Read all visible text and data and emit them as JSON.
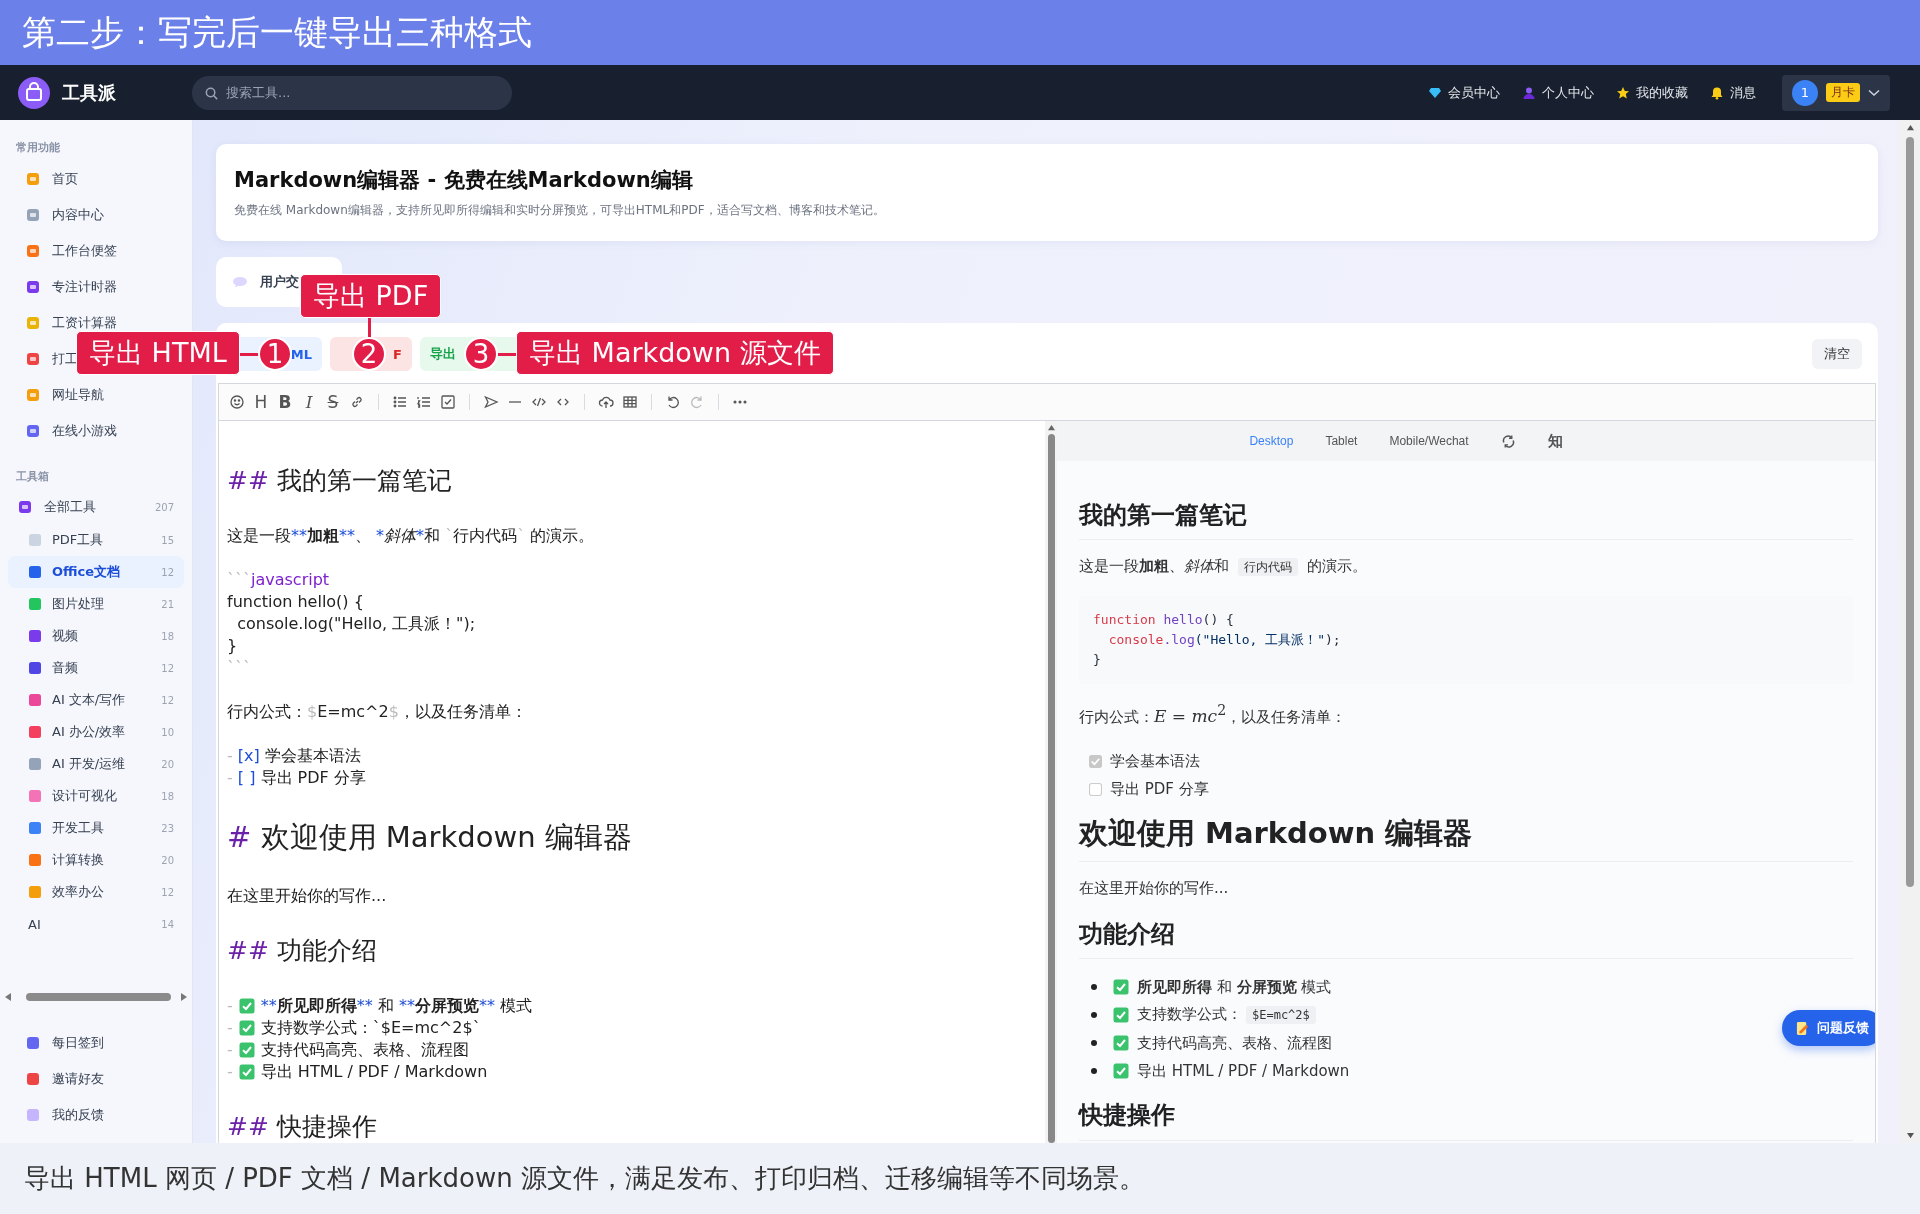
{
  "banner": {
    "title": "第二步：写完后一键导出三种格式"
  },
  "navbar": {
    "brand": "工具派",
    "search": {
      "placeholder": "搜索工具..."
    },
    "links": [
      {
        "kind": "vip",
        "label": "会员中心"
      },
      {
        "kind": "user",
        "label": "个人中心"
      },
      {
        "kind": "star",
        "label": "我的收藏"
      },
      {
        "kind": "bell",
        "label": "消息"
      }
    ],
    "account": {
      "avatar": "1",
      "badge": "月卡"
    }
  },
  "sidebar": {
    "sections": [
      {
        "title": "常用功能",
        "items": [
          {
            "label": "首页",
            "selected": false
          },
          {
            "label": "内容中心",
            "selected": false
          },
          {
            "label": "工作台便签",
            "selected": false
          },
          {
            "label": "专注计时器",
            "selected": false
          },
          {
            "label": "工资计算器",
            "selected": false
          },
          {
            "label": "打工",
            "selected": false
          },
          {
            "label": "网址导航",
            "selected": false
          },
          {
            "label": "在线小游戏",
            "selected": false
          }
        ]
      },
      {
        "title": "工具箱",
        "items": [
          {
            "label": "全部工具",
            "count": "207",
            "selected": false,
            "children": [
              {
                "label": "PDF工具",
                "count": "15",
                "selected": false
              },
              {
                "label": "Office文档",
                "count": "12",
                "selected": true
              },
              {
                "label": "图片处理",
                "count": "21",
                "selected": false
              },
              {
                "label": "视频",
                "count": "18",
                "selected": false
              },
              {
                "label": "音频",
                "count": "12",
                "selected": false
              },
              {
                "label": "AI 文本/写作",
                "count": "12",
                "selected": false
              },
              {
                "label": "AI 办公/效率",
                "count": "10",
                "selected": false
              },
              {
                "label": "AI 开发/运维",
                "count": "20",
                "selected": false
              },
              {
                "label": "设计可视化",
                "count": "18",
                "selected": false
              },
              {
                "label": "开发工具",
                "count": "23",
                "selected": false
              },
              {
                "label": "计算转换",
                "count": "20",
                "selected": false
              },
              {
                "label": "效率办公",
                "count": "12",
                "selected": false
              },
              {
                "label": "AI",
                "count": "14",
                "selected": false,
                "kind": "plain"
              }
            ]
          }
        ]
      }
    ],
    "footer_items": [
      {
        "label": "每日签到"
      },
      {
        "label": "邀请好友"
      },
      {
        "label": "我的反馈"
      }
    ]
  },
  "page_header": {
    "title": "Markdown编辑器 - 免费在线Markdown编辑",
    "description": "免费在线 Markdown编辑器，支持所见即所得编辑和实时分屏预览，可导出HTML和PDF，适合写文档、博客和技术笔记。"
  },
  "tab": {
    "label": "用户交"
  },
  "export_buttons": [
    {
      "kind": "html",
      "label": "ML"
    },
    {
      "kind": "pdf",
      "label": "F"
    },
    {
      "kind": "markdown",
      "label": "导出"
    }
  ],
  "clear_button": "清空",
  "toolbar": [
    {
      "kind": "emoji",
      "disabled": false
    },
    {
      "kind": "heading",
      "text": "H",
      "disabled": false
    },
    {
      "kind": "bold",
      "text": "B",
      "disabled": false
    },
    {
      "kind": "italic",
      "text": "I",
      "disabled": false
    },
    {
      "kind": "strike",
      "text": "S",
      "disabled": false
    },
    {
      "kind": "link",
      "disabled": false
    },
    {
      "kind": "sep"
    },
    {
      "kind": "list",
      "disabled": false
    },
    {
      "kind": "ordered",
      "disabled": false
    },
    {
      "kind": "task",
      "disabled": false
    },
    {
      "kind": "sep"
    },
    {
      "kind": "quote",
      "disabled": false
    },
    {
      "kind": "line",
      "disabled": false
    },
    {
      "kind": "code",
      "disabled": false
    },
    {
      "kind": "inline-code",
      "disabled": false
    },
    {
      "kind": "sep"
    },
    {
      "kind": "upload",
      "disabled": false
    },
    {
      "kind": "table",
      "disabled": false
    },
    {
      "kind": "sep"
    },
    {
      "kind": "undo",
      "disabled": false
    },
    {
      "kind": "redo",
      "disabled": true
    },
    {
      "kind": "sep"
    },
    {
      "kind": "more",
      "disabled": false
    }
  ],
  "source_lines": [
    {
      "kind": "h2",
      "marker": "##",
      "text": "我的第一篇笔记"
    },
    {
      "kind": "blank"
    },
    {
      "kind": "text",
      "parts": [
        {
          "t": "这是一段"
        },
        {
          "t": "**",
          "kind": "mark"
        },
        {
          "t": "加粗",
          "kind": "bold"
        },
        {
          "t": "**",
          "kind": "mark"
        },
        {
          "t": "、 "
        },
        {
          "t": "*",
          "kind": "mark"
        },
        {
          "t": "斜体",
          "kind": "italic"
        },
        {
          "t": "*",
          "kind": "mark"
        },
        {
          "t": "和 "
        },
        {
          "t": "`",
          "kind": "dim"
        },
        {
          "t": "行内代码"
        },
        {
          "t": "`",
          "kind": "dim"
        },
        {
          "t": " 的演示。"
        }
      ]
    },
    {
      "kind": "blank"
    },
    {
      "kind": "text",
      "parts": [
        {
          "t": "```",
          "kind": "dim"
        },
        {
          "t": "javascript",
          "kind": "lang"
        }
      ]
    },
    {
      "kind": "text",
      "parts": [
        {
          "t": "function hello() {"
        }
      ]
    },
    {
      "kind": "text",
      "parts": [
        {
          "t": "  console.log(\"Hello, 工具派！\");"
        }
      ]
    },
    {
      "kind": "text",
      "parts": [
        {
          "t": "}"
        }
      ]
    },
    {
      "kind": "text",
      "parts": [
        {
          "t": "```",
          "kind": "dim"
        }
      ]
    },
    {
      "kind": "blank"
    },
    {
      "kind": "text",
      "parts": [
        {
          "t": "行内公式："
        },
        {
          "t": "$",
          "kind": "dim"
        },
        {
          "t": "E=mc^2"
        },
        {
          "t": "$",
          "kind": "dim"
        },
        {
          "t": "，以及任务清单："
        }
      ]
    },
    {
      "kind": "blank"
    },
    {
      "kind": "text",
      "parts": [
        {
          "t": "- ",
          "kind": "dim"
        },
        {
          "t": "[x]",
          "kind": "box"
        },
        {
          "t": " 学会基本语法"
        }
      ]
    },
    {
      "kind": "text",
      "parts": [
        {
          "t": "- ",
          "kind": "dim"
        },
        {
          "t": "[ ]",
          "kind": "box"
        },
        {
          "t": " 导出 PDF 分享"
        }
      ]
    },
    {
      "kind": "blank"
    },
    {
      "kind": "h1",
      "marker": "#",
      "text": "欢迎使用 Markdown 编辑器"
    },
    {
      "kind": "blank"
    },
    {
      "kind": "text",
      "parts": [
        {
          "t": "在这里开始你的写作..."
        }
      ]
    },
    {
      "kind": "blank"
    },
    {
      "kind": "h2",
      "marker": "##",
      "text": "功能介绍"
    },
    {
      "kind": "blank"
    },
    {
      "kind": "check",
      "dash": "-",
      "parts": [
        {
          "t": "**",
          "kind": "mark"
        },
        {
          "t": "所见即所得",
          "kind": "bold"
        },
        {
          "t": "**",
          "kind": "mark"
        },
        {
          "t": " 和 "
        },
        {
          "t": "**",
          "kind": "mark"
        },
        {
          "t": "分屏预览",
          "kind": "bold"
        },
        {
          "t": "**",
          "kind": "mark"
        },
        {
          "t": " 模式"
        }
      ]
    },
    {
      "kind": "check",
      "dash": "-",
      "parts": [
        {
          "t": "支持数学公式：`$E=mc^2$`"
        }
      ]
    },
    {
      "kind": "check",
      "dash": "-",
      "parts": [
        {
          "t": "支持代码高亮、表格、流程图"
        }
      ]
    },
    {
      "kind": "check",
      "dash": "-",
      "parts": [
        {
          "t": "导出 HTML / PDF / Markdown"
        }
      ]
    },
    {
      "kind": "blank"
    },
    {
      "kind": "h2",
      "marker": "##",
      "text": "快捷操作"
    }
  ],
  "preview": {
    "tabs": [
      {
        "label": "Desktop",
        "selected": true
      },
      {
        "label": "Tablet",
        "selected": false
      },
      {
        "label": "Mobile/Wechat",
        "selected": false
      }
    ],
    "zhihu": "知",
    "blocks": [
      {
        "kind": "h2",
        "text": "我的第一篇笔记"
      },
      {
        "kind": "p",
        "parts": [
          {
            "t": "这是一段"
          },
          {
            "t": "加粗",
            "kind": "bold"
          },
          {
            "t": "、"
          },
          {
            "t": "斜体",
            "kind": "italic"
          },
          {
            "t": "和 "
          },
          {
            "t": "行内代码",
            "kind": "code"
          },
          {
            "t": " 的演示。"
          }
        ]
      },
      {
        "kind": "code",
        "lines": [
          [
            {
              "t": "function ",
              "kind": "kw"
            },
            {
              "t": "hello",
              "kind": "fn"
            },
            {
              "t": "() {"
            }
          ],
          [
            {
              "t": "  console",
              "kind": "kw"
            },
            {
              "t": ".log",
              "kind": "fn"
            },
            {
              "t": "(\"Hello, 工具派！\"",
              "kind": "str"
            },
            {
              "t": ");"
            }
          ],
          [
            {
              "t": "}"
            }
          ]
        ]
      },
      {
        "kind": "p",
        "parts": [
          {
            "t": "行内公式："
          },
          {
            "t": "*E* = *mc*$^{2}$",
            "kind": "math"
          },
          {
            "t": "，以及任务清单："
          }
        ]
      },
      {
        "kind": "tasks",
        "items": [
          {
            "checked": true,
            "text": "学会基本语法"
          },
          {
            "checked": false,
            "text": "导出 PDF 分享"
          }
        ]
      },
      {
        "kind": "h1",
        "text": "欢迎使用 Markdown 编辑器"
      },
      {
        "kind": "p",
        "parts": [
          {
            "t": "在这里开始你的写作..."
          }
        ]
      },
      {
        "kind": "h2",
        "text": "功能介绍"
      },
      {
        "kind": "ul",
        "items": [
          [
            {
              "t": "所见即所得",
              "kind": "bold"
            },
            {
              "t": " 和 "
            },
            {
              "t": "分屏预览",
              "kind": "bold"
            },
            {
              "t": " 模式"
            }
          ],
          [
            {
              "t": "支持数学公式："
            },
            {
              "t": "$E=mc^2$",
              "kind": "code"
            }
          ],
          [
            {
              "t": "支持代码高亮、表格、流程图"
            }
          ],
          [
            {
              "t": "导出 HTML / PDF / Markdown"
            }
          ]
        ]
      },
      {
        "kind": "h2",
        "text": "快捷操作"
      }
    ]
  },
  "feedback_button": "问题反馈",
  "callouts": [
    {
      "number": "1",
      "label": "导出 HTML"
    },
    {
      "number": "2",
      "label": "导出 PDF"
    },
    {
      "number": "3",
      "label": "导出 Markdown 源文件"
    }
  ],
  "caption": "导出 HTML 网页 / PDF 文档 / Markdown 源文件，满足发布、打印归档、迁移编辑等不同场景。"
}
